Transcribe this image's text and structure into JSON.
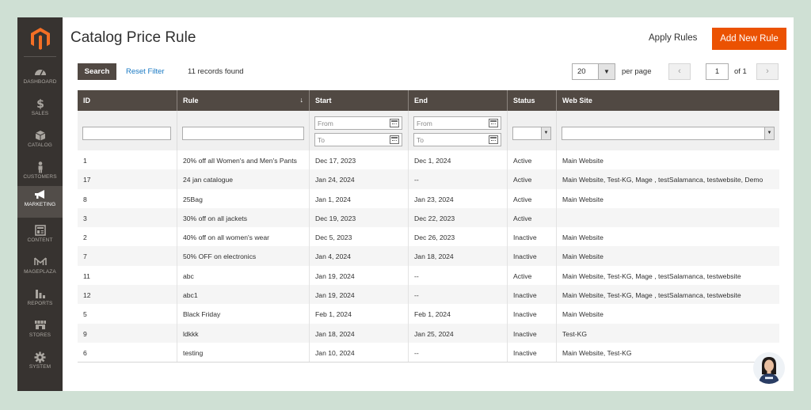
{
  "sidebar": {
    "items": [
      {
        "label": "DASHBOARD",
        "icon": "dashboard-icon"
      },
      {
        "label": "SALES",
        "icon": "dollar-icon"
      },
      {
        "label": "CATALOG",
        "icon": "catalog-box-icon"
      },
      {
        "label": "CUSTOMERS",
        "icon": "customer-person-icon"
      },
      {
        "label": "MARKETING",
        "icon": "megaphone-icon"
      },
      {
        "label": "CONTENT",
        "icon": "content-layout-icon"
      },
      {
        "label": "MAGEPLAZA",
        "icon": "mageplaza-logo-icon"
      },
      {
        "label": "REPORTS",
        "icon": "bar-chart-icon"
      },
      {
        "label": "STORES",
        "icon": "store-icon"
      },
      {
        "label": "SYSTEM",
        "icon": "gear-icon"
      }
    ]
  },
  "header": {
    "title": "Catalog Price Rule",
    "apply_rules": "Apply Rules",
    "add_new_rule": "Add New Rule"
  },
  "toolbar": {
    "search_label": "Search",
    "reset_filter": "Reset Filter",
    "records_found": "11 records found",
    "per_page_value": "20",
    "per_page_label": "per page",
    "prev_icon": "‹",
    "next_icon": "›",
    "current_page": "1",
    "page_of": "of 1"
  },
  "grid": {
    "columns": [
      "ID",
      "Rule",
      "Start",
      "End",
      "Status",
      "Web Site"
    ],
    "sort_indicator": "↓",
    "filters": {
      "from_placeholder": "From",
      "to_placeholder": "To"
    },
    "rows": [
      {
        "id": "1",
        "rule": "20% off all Women's and Men's Pants",
        "start": "Dec 17, 2023",
        "end": "Dec 1, 2024",
        "status": "Active",
        "website": "Main Website"
      },
      {
        "id": "17",
        "rule": "24 jan catalogue",
        "start": "Jan 24, 2024",
        "end": "--",
        "status": "Active",
        "website": "Main Website, Test-KG, Mage , testSalamanca, testwebsite, Demo"
      },
      {
        "id": "8",
        "rule": "25Bag",
        "start": "Jan 1, 2024",
        "end": "Jan 23, 2024",
        "status": "Active",
        "website": "Main Website"
      },
      {
        "id": "3",
        "rule": "30% off on all jackets",
        "start": "Dec 19, 2023",
        "end": "Dec 22, 2023",
        "status": "Active",
        "website": ""
      },
      {
        "id": "2",
        "rule": "40% off on all women's wear",
        "start": "Dec 5, 2023",
        "end": "Dec 26, 2023",
        "status": "Inactive",
        "website": "Main Website"
      },
      {
        "id": "7",
        "rule": "50% OFF on electronics",
        "start": "Jan 4, 2024",
        "end": "Jan 18, 2024",
        "status": "Inactive",
        "website": "Main Website"
      },
      {
        "id": "11",
        "rule": "abc",
        "start": "Jan 19, 2024",
        "end": "--",
        "status": "Active",
        "website": "Main Website, Test-KG, Mage , testSalamanca, testwebsite"
      },
      {
        "id": "12",
        "rule": "abc1",
        "start": "Jan 19, 2024",
        "end": "--",
        "status": "Inactive",
        "website": "Main Website, Test-KG, Mage , testSalamanca, testwebsite"
      },
      {
        "id": "5",
        "rule": "Black Friday",
        "start": "Feb 1, 2024",
        "end": "Feb 1, 2024",
        "status": "Inactive",
        "website": "Main Website"
      },
      {
        "id": "9",
        "rule": "ldkkk",
        "start": "Jan 18, 2024",
        "end": "Jan 25, 2024",
        "status": "Inactive",
        "website": "Test-KG"
      },
      {
        "id": "6",
        "rule": "testing",
        "start": "Jan 10, 2024",
        "end": "--",
        "status": "Inactive",
        "website": "Main Website, Test-KG"
      }
    ]
  },
  "colors": {
    "sidebar_bg": "#373330",
    "accent": "#eb5202",
    "header_bg": "#514943",
    "link": "#1979c3"
  }
}
